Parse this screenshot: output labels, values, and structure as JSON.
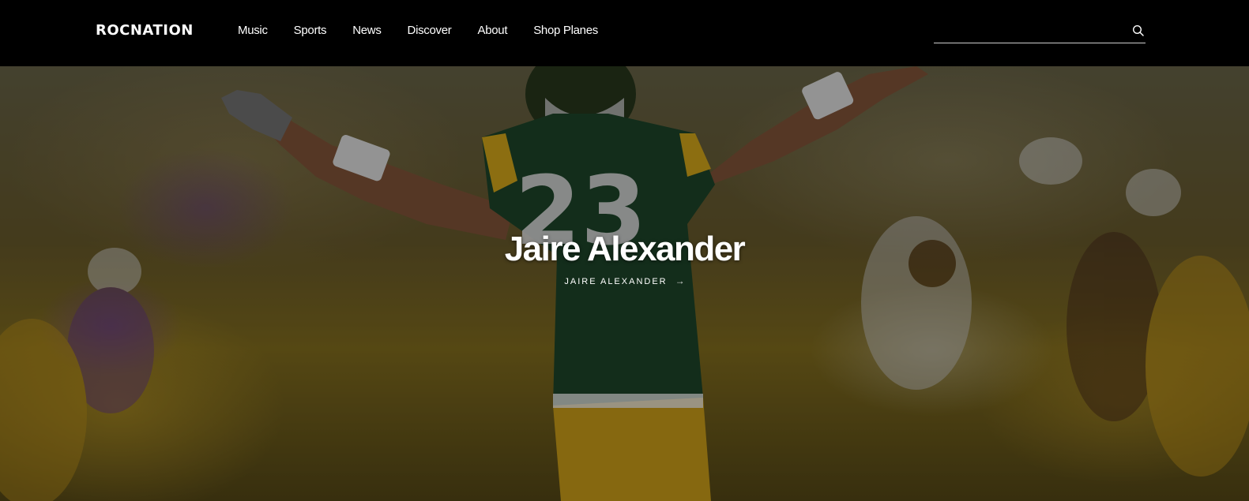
{
  "header": {
    "logo": "ROCNATION",
    "nav": [
      {
        "label": "Music"
      },
      {
        "label": "Sports"
      },
      {
        "label": "News"
      },
      {
        "label": "Discover"
      },
      {
        "label": "About"
      },
      {
        "label": "Shop Planes"
      }
    ],
    "search": {
      "placeholder": "",
      "value": "",
      "icon": "search-icon"
    }
  },
  "hero": {
    "title": "Jaire Alexander",
    "link_label": "JAIRE ALEXANDER",
    "link_icon": "arrow-right-icon",
    "image_alt": "player-photo",
    "jersey_number": "23",
    "colors": {
      "jersey_green": "#1f4a2c",
      "jersey_yellow": "#e2b21c",
      "pants_yellow": "#d9a91a"
    }
  }
}
